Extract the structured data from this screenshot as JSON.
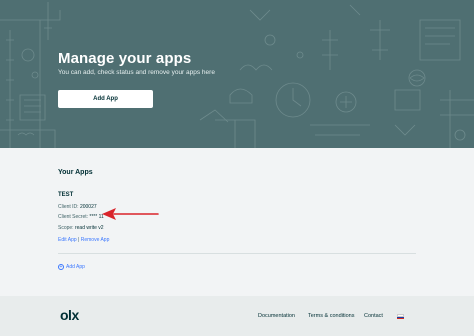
{
  "hero": {
    "title": "Manage your apps",
    "subtitle": "You can add, check status and remove your apps here",
    "add_button_label": "Add App",
    "background_color": "#4f6f72"
  },
  "apps_section": {
    "heading": "Your Apps",
    "apps": [
      {
        "name": "TEST",
        "client_id_label": "Client ID:",
        "client_id": "200027",
        "client_secret_label": "Client Secret:",
        "client_secret": "**** 11",
        "scope_label": "Scope:",
        "scope": "read write v2",
        "edit_label": "Edit App",
        "separator": "|",
        "remove_label": "Remove App"
      }
    ],
    "add_app_label": "Add App",
    "link_color": "#3a77ff"
  },
  "annotation": {
    "arrow_color": "#d9232a",
    "icon": "arrow-left-icon"
  },
  "footer": {
    "logo_text": "olx",
    "nav": [
      "Documentation",
      "Terms & conditions",
      "Contact"
    ],
    "flag_colors": [
      "#ffffff",
      "#1c3fa8",
      "#d52b1e"
    ]
  }
}
